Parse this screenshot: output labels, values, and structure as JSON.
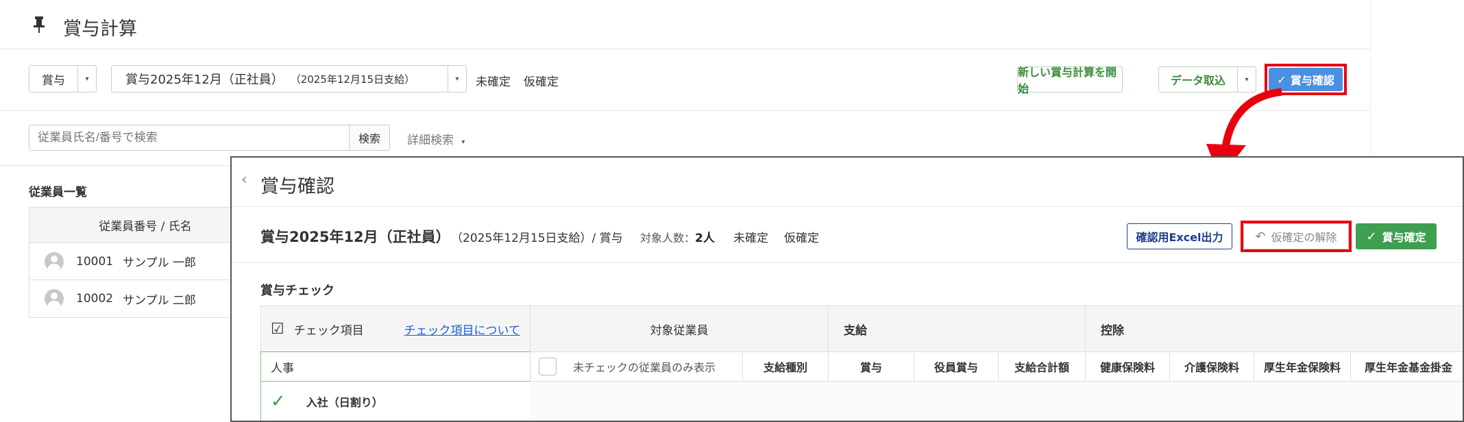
{
  "background": {
    "page_title": "賞与計算",
    "pin_icon": "pin-icon",
    "type_select": "賞与",
    "period_select": "賞与2025年12月（正社員）",
    "period_sub": "（2025年12月15日支給）",
    "status_unconfirmed": "未確定",
    "status_provisional": "仮確定",
    "new_calc_button": "新しい賞与計算を開始",
    "import_button": "データ取込",
    "confirm_button": "賞与確認",
    "search_placeholder": "従業員氏名/番号で検索",
    "search_button": "検索",
    "advanced_search": "詳細検索",
    "employee_list_title": "従業員一覧",
    "employee_list_header": "従業員番号 / 氏名",
    "employees": [
      {
        "id": "10001",
        "name": "サンプル 一郎"
      },
      {
        "id": "10002",
        "name": "サンプル 二郎"
      }
    ]
  },
  "panel": {
    "title": "賞与確認",
    "bonus_name": "賞与2025年12月（正社員）",
    "bonus_sub": "（2025年12月15日支給）/ 賞与",
    "target_count_label": "対象人数：",
    "target_count_value": "2人",
    "status_unconfirmed": "未確定",
    "status_provisional": "仮確定",
    "excel_button": "確認用Excel出力",
    "cancel_provisional_button": "仮確定の解除",
    "confirm_button": "賞与確定",
    "check_section_title": "賞与チェック",
    "check_items_label": "チェック項目",
    "check_items_link": "チェック項目について",
    "target_employees_label": "対象従業員",
    "payment_label": "支給",
    "deduction_label": "控除",
    "hr_label": "人事",
    "unchecked_only_label": "未チェックの従業員のみ表示",
    "payment_type_label": "支給種別",
    "columns": [
      "賞与",
      "役員賞与",
      "支給合計額",
      "健康保険料",
      "介護保険料",
      "厚生年金保険料",
      "厚生年金基金掛金"
    ],
    "check_row_label": "入社（日割り）"
  },
  "colors": {
    "highlight_red": "#e8000f",
    "confirm_blue": "#4a90e2",
    "confirm_green": "#3f9e50",
    "link_blue": "#1a5fd6"
  }
}
